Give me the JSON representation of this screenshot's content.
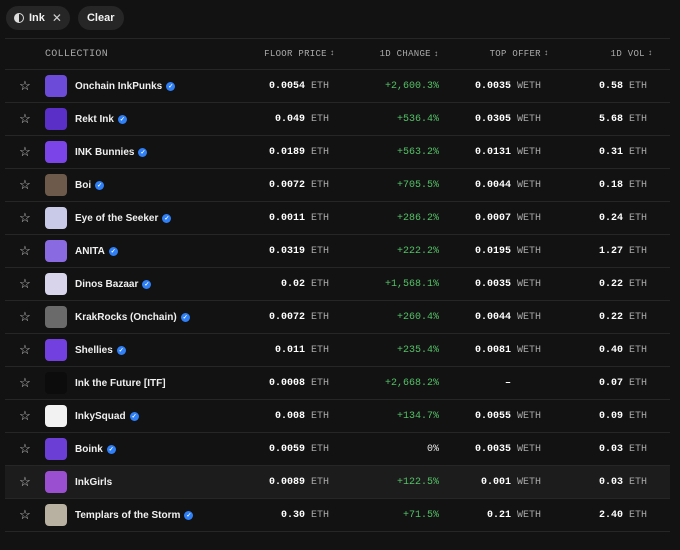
{
  "filters": {
    "chip_label": "Ink",
    "clear_label": "Clear"
  },
  "headers": {
    "collection": "COLLECTION",
    "floor": "FLOOR PRICE",
    "change": "1D CHANGE",
    "offer": "TOP OFFER",
    "volume": "1D VOL",
    "sort_icon": "↕"
  },
  "colors": {
    "positive": "#54c067",
    "verified": "#2f7ff6",
    "background": "#121212"
  },
  "rows": [
    {
      "name": "Onchain InkPunks",
      "floor": "0.0054",
      "floor_unit": "ETH",
      "change": "+2,600.3%",
      "offer": "0.0035",
      "offer_unit": "WETH",
      "vol": "0.58",
      "vol_unit": "ETH",
      "verified": true,
      "avatar": "#6c4bd8"
    },
    {
      "name": "Rekt Ink",
      "floor": "0.049",
      "floor_unit": "ETH",
      "change": "+536.4%",
      "offer": "0.0305",
      "offer_unit": "WETH",
      "vol": "5.68",
      "vol_unit": "ETH",
      "verified": true,
      "avatar": "#5a2fc7"
    },
    {
      "name": "INK Bunnies",
      "floor": "0.0189",
      "floor_unit": "ETH",
      "change": "+563.2%",
      "offer": "0.0131",
      "offer_unit": "WETH",
      "vol": "0.31",
      "vol_unit": "ETH",
      "verified": true,
      "avatar": "#7a44e8"
    },
    {
      "name": "Boi",
      "floor": "0.0072",
      "floor_unit": "ETH",
      "change": "+705.5%",
      "offer": "0.0044",
      "offer_unit": "WETH",
      "vol": "0.18",
      "vol_unit": "ETH",
      "verified": true,
      "avatar": "#6d5a4a"
    },
    {
      "name": "Eye of the Seeker",
      "floor": "0.0011",
      "floor_unit": "ETH",
      "change": "+286.2%",
      "offer": "0.0007",
      "offer_unit": "WETH",
      "vol": "0.24",
      "vol_unit": "ETH",
      "verified": true,
      "avatar": "#c9c9e8"
    },
    {
      "name": "ANITA",
      "floor": "0.0319",
      "floor_unit": "ETH",
      "change": "+222.2%",
      "offer": "0.0195",
      "offer_unit": "WETH",
      "vol": "1.27",
      "vol_unit": "ETH",
      "verified": true,
      "avatar": "#8a6ae0"
    },
    {
      "name": "Dinos Bazaar",
      "floor": "0.02",
      "floor_unit": "ETH",
      "change": "+1,568.1%",
      "offer": "0.0035",
      "offer_unit": "WETH",
      "vol": "0.22",
      "vol_unit": "ETH",
      "verified": true,
      "avatar": "#d8d4ec"
    },
    {
      "name": "KrakRocks (Onchain)",
      "floor": "0.0072",
      "floor_unit": "ETH",
      "change": "+260.4%",
      "offer": "0.0044",
      "offer_unit": "WETH",
      "vol": "0.22",
      "vol_unit": "ETH",
      "verified": true,
      "avatar": "#6a6a6a"
    },
    {
      "name": "Shellies",
      "floor": "0.011",
      "floor_unit": "ETH",
      "change": "+235.4%",
      "offer": "0.0081",
      "offer_unit": "WETH",
      "vol": "0.40",
      "vol_unit": "ETH",
      "verified": true,
      "avatar": "#7340e0"
    },
    {
      "name": "Ink the Future [ITF]",
      "floor": "0.0008",
      "floor_unit": "ETH",
      "change": "+2,668.2%",
      "offer": "–",
      "offer_unit": "",
      "vol": "0.07",
      "vol_unit": "ETH",
      "verified": false,
      "avatar": "#0c0c0c"
    },
    {
      "name": "InkySquad",
      "floor": "0.008",
      "floor_unit": "ETH",
      "change": "+134.7%",
      "offer": "0.0055",
      "offer_unit": "WETH",
      "vol": "0.09",
      "vol_unit": "ETH",
      "verified": true,
      "avatar": "#f2f2f2"
    },
    {
      "name": "Boink",
      "floor": "0.0059",
      "floor_unit": "ETH",
      "change": "0%",
      "offer": "0.0035",
      "offer_unit": "WETH",
      "vol": "0.03",
      "vol_unit": "ETH",
      "verified": true,
      "avatar": "#6b3ed6"
    },
    {
      "name": "InkGirls",
      "floor": "0.0089",
      "floor_unit": "ETH",
      "change": "+122.5%",
      "offer": "0.001",
      "offer_unit": "WETH",
      "vol": "0.03",
      "vol_unit": "ETH",
      "verified": false,
      "avatar": "#9a4fd0"
    },
    {
      "name": "Templars of the Storm",
      "floor": "0.30",
      "floor_unit": "ETH",
      "change": "+71.5%",
      "offer": "0.21",
      "offer_unit": "WETH",
      "vol": "2.40",
      "vol_unit": "ETH",
      "verified": true,
      "avatar": "#b8b0a0"
    }
  ]
}
